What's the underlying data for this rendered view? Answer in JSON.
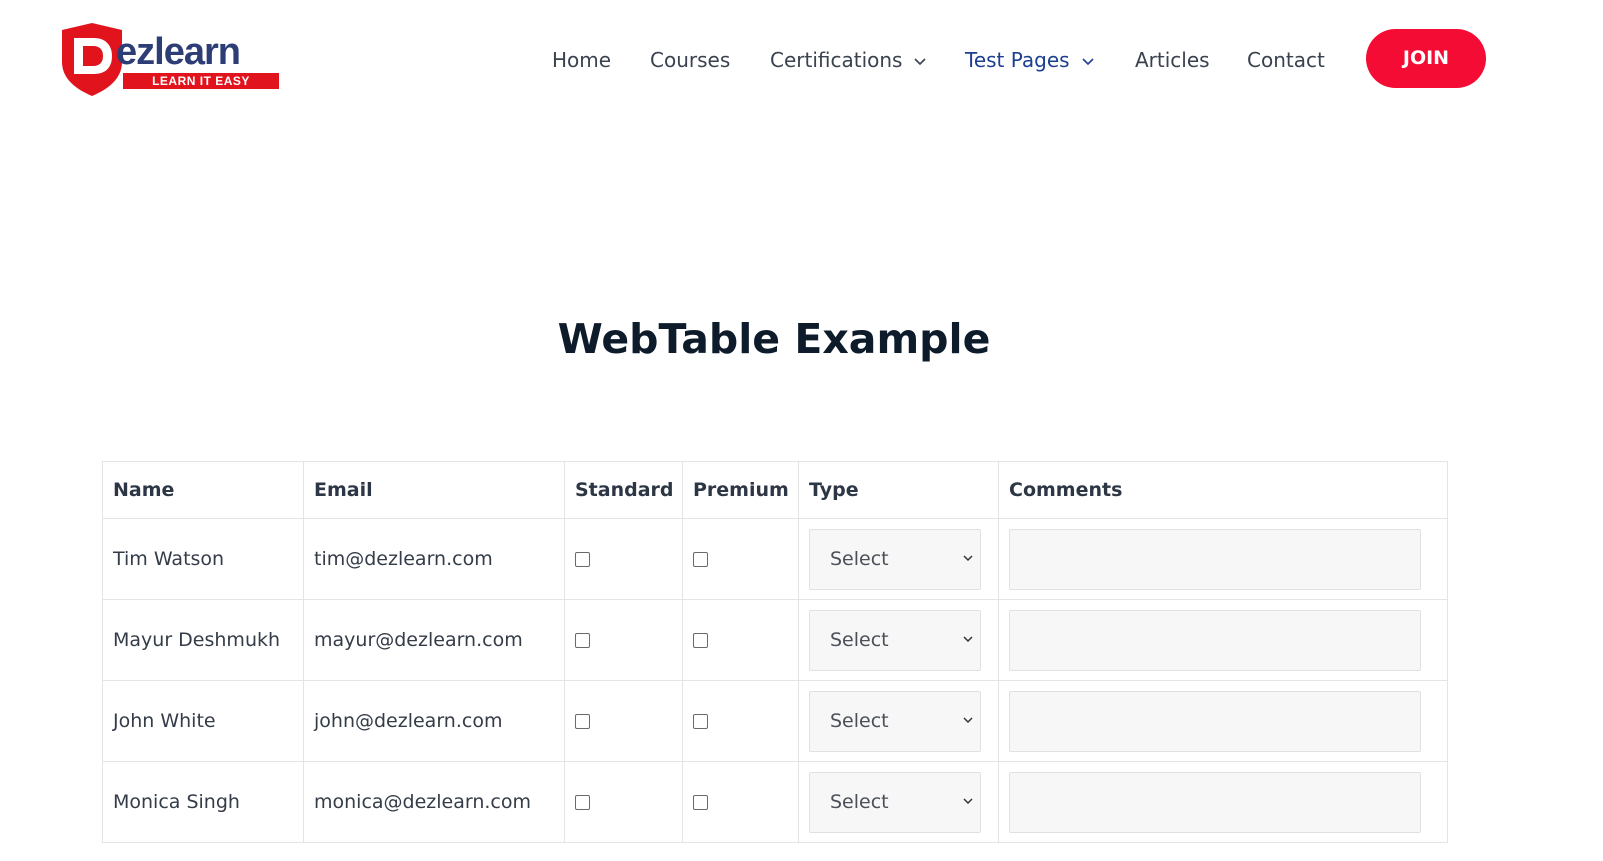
{
  "logo": {
    "letter": "D",
    "word": "ezlearn",
    "tagline": "LEARN IT EASY"
  },
  "nav": {
    "items": [
      {
        "label": "Home"
      },
      {
        "label": "Courses"
      },
      {
        "label": "Certifications",
        "has_dropdown": true
      },
      {
        "label": "Test Pages",
        "has_dropdown": true,
        "active": true
      },
      {
        "label": "Articles"
      },
      {
        "label": "Contact"
      }
    ],
    "join_label": "JOIN"
  },
  "page": {
    "title": "WebTable Example"
  },
  "table": {
    "headers": [
      "Name",
      "Email",
      "Standard",
      "Premium",
      "Type",
      "Comments"
    ],
    "rows": [
      {
        "name": "Tim Watson",
        "email": "tim@dezlearn.com",
        "standard": false,
        "premium": false,
        "type": "Select",
        "comment": ""
      },
      {
        "name": "Mayur Deshmukh",
        "email": "mayur@dezlearn.com",
        "standard": false,
        "premium": false,
        "type": "Select",
        "comment": ""
      },
      {
        "name": "John White",
        "email": "john@dezlearn.com",
        "standard": false,
        "premium": false,
        "type": "Select",
        "comment": ""
      },
      {
        "name": "Monica Singh",
        "email": "monica@dezlearn.com",
        "standard": false,
        "premium": false,
        "type": "Select",
        "comment": ""
      }
    ]
  },
  "colors": {
    "brand_red": "#e1131c",
    "join_red": "#f50c35",
    "nav_active": "#1d3f8f",
    "logo_blue": "#2c3e75"
  },
  "icons": {
    "logo": "dezlearn-shield-logo",
    "dropdown": "chevron-down-icon",
    "checkbox": "checkbox-empty-icon"
  }
}
